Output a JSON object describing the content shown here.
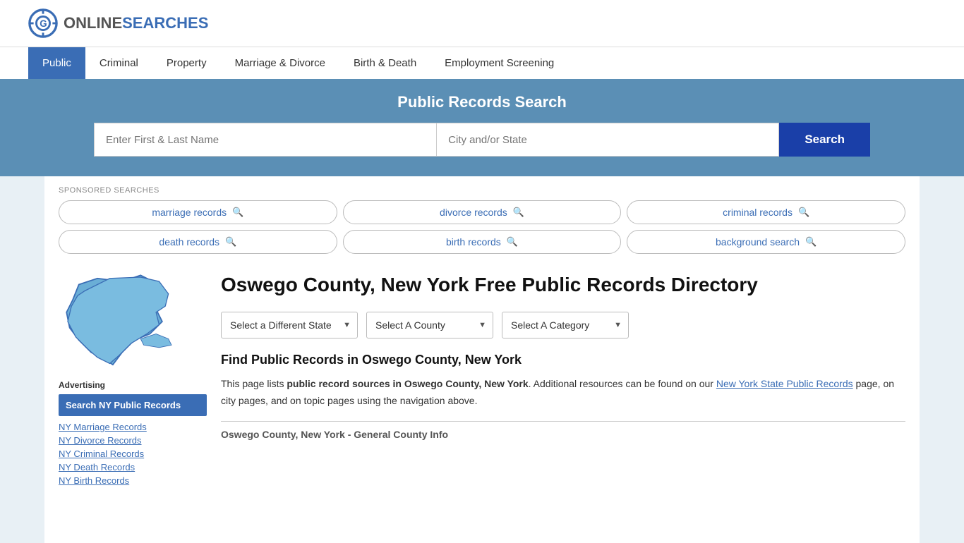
{
  "logo": {
    "text_online": "ONLINE",
    "text_searches": "SEARCHES",
    "aria": "OnlineSearches logo"
  },
  "nav": {
    "items": [
      {
        "label": "Public",
        "active": true
      },
      {
        "label": "Criminal",
        "active": false
      },
      {
        "label": "Property",
        "active": false
      },
      {
        "label": "Marriage & Divorce",
        "active": false
      },
      {
        "label": "Birth & Death",
        "active": false
      },
      {
        "label": "Employment Screening",
        "active": false
      }
    ]
  },
  "search_banner": {
    "title": "Public Records Search",
    "name_placeholder": "Enter First & Last Name",
    "location_placeholder": "City and/or State",
    "button_label": "Search"
  },
  "sponsored": {
    "label": "SPONSORED SEARCHES",
    "links": [
      {
        "label": "marriage records"
      },
      {
        "label": "divorce records"
      },
      {
        "label": "criminal records"
      },
      {
        "label": "death records"
      },
      {
        "label": "birth records"
      },
      {
        "label": "background search"
      }
    ]
  },
  "page": {
    "title": "Oswego County, New York Free Public Records Directory",
    "section_heading": "Find Public Records in Oswego County, New York",
    "description_part1": "This page lists ",
    "description_bold": "public record sources in Oswego County, New York",
    "description_part2": ". Additional resources can be found on our ",
    "description_link_text": "New York State Public Records",
    "description_part3": " page, on city pages, and on topic pages using the navigation above.",
    "county_info_label": "Oswego County, New York - General County Info"
  },
  "dropdowns": {
    "state": {
      "label": "Select a Different State",
      "options": [
        "Select a Different State"
      ]
    },
    "county": {
      "label": "Select A County",
      "options": [
        "Select A County"
      ]
    },
    "category": {
      "label": "Select A Category",
      "options": [
        "Select A Category"
      ]
    }
  },
  "sidebar": {
    "advertising_label": "Advertising",
    "ad_box_text": "Search NY Public Records",
    "links": [
      {
        "label": "NY Marriage Records"
      },
      {
        "label": "NY Divorce Records"
      },
      {
        "label": "NY Criminal Records"
      },
      {
        "label": "NY Death Records"
      },
      {
        "label": "NY Birth Records"
      }
    ]
  }
}
